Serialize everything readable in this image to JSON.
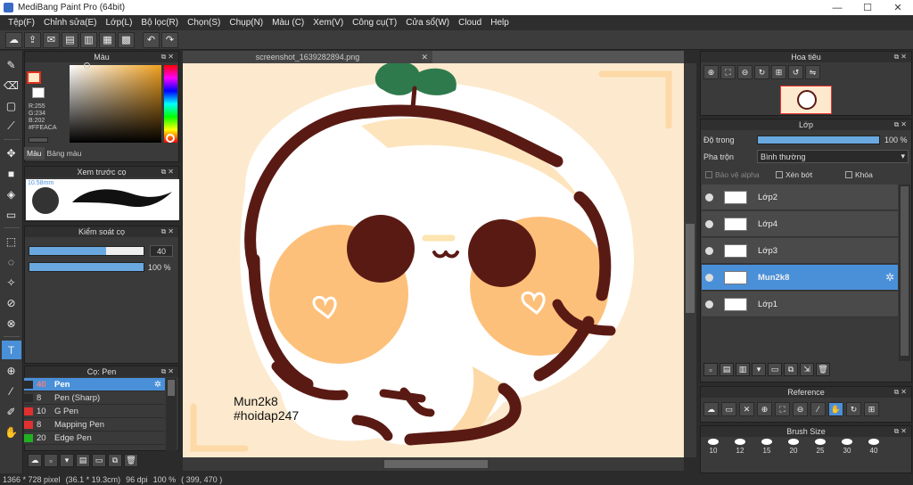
{
  "titlebar": {
    "title": "MediBang Paint Pro (64bit)",
    "minimize": "—",
    "maximize": "☐",
    "close": "✕"
  },
  "menu": [
    "Tệp(F)",
    "Chỉnh sửa(E)",
    "Lớp(L)",
    "Bộ lọc(R)",
    "Chọn(S)",
    "Chụp(N)",
    "Màu (C)",
    "Xem(V)",
    "Công cụ(T)",
    "Cửa sổ(W)",
    "Cloud",
    "Help"
  ],
  "color_panel": {
    "title": "Màu",
    "r": "R:255",
    "g": "G:234",
    "b": "B:202",
    "hex": "#FFEACA",
    "tab_color": "Màu",
    "tab_palette": "Bảng màu",
    "front_color": "#FFEACA"
  },
  "brush_preview": {
    "title": "Xem trước cọ",
    "size_label": "10.58mm"
  },
  "brush_control": {
    "title": "Kiểm soát cọ",
    "size_value": "40",
    "size_fraction": 0.67,
    "opacity_value": "100 %",
    "opacity_fraction": 1.0
  },
  "brush_list": {
    "title": "Cọ: Pen",
    "items": [
      {
        "size": "40",
        "name": "Pen",
        "color": "#2a2a2a",
        "selected": true
      },
      {
        "size": "8",
        "name": "Pen (Sharp)",
        "color": "#2a2a2a",
        "selected": false
      },
      {
        "size": "10",
        "name": "G Pen",
        "color": "#e03030",
        "selected": false
      },
      {
        "size": "8",
        "name": "Mapping Pen",
        "color": "#e03030",
        "selected": false
      },
      {
        "size": "20",
        "name": "Edge Pen",
        "color": "#20b020",
        "selected": false
      }
    ]
  },
  "canvas": {
    "tab_title": "screenshot_1639282894.png",
    "text_line1": "Mun2k8",
    "text_line2": "#hoidap247"
  },
  "navigator": {
    "title": "Hoa tiêu"
  },
  "layer_panel": {
    "title": "Lớp",
    "opacity_label": "Độ trong",
    "opacity_value": "100 %",
    "opacity_fraction": 1.0,
    "blend_label": "Pha trộn",
    "blend_value": "Bình thường",
    "protect_alpha": "Bảo vệ alpha",
    "clipping": "Xén bớt",
    "lock": "Khóa",
    "layers": [
      {
        "name": "Lớp2",
        "selected": false
      },
      {
        "name": "Lớp4",
        "selected": false
      },
      {
        "name": "Lớp3",
        "selected": false
      },
      {
        "name": "Mun2k8",
        "selected": true
      },
      {
        "name": "Lớp1",
        "selected": false
      }
    ]
  },
  "reference_panel": {
    "title": "Reference"
  },
  "brush_size_panel": {
    "title": "Brush Size",
    "sizes": [
      "10",
      "12",
      "15",
      "20",
      "25",
      "30",
      "40"
    ]
  },
  "status": {
    "canvas_size": "1366 * 728 pixel",
    "physical": "(36.1 * 19.3cm)",
    "dpi": "96 dpi",
    "zoom": "100 %",
    "cursor": "( 399, 470 )"
  }
}
